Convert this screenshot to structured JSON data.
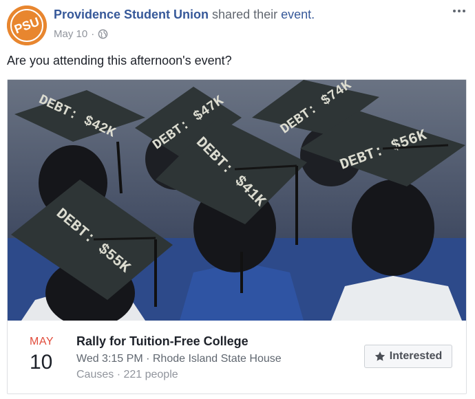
{
  "post": {
    "author": "Providence Student Union",
    "action": "shared their",
    "event_link": "event.",
    "date": "May 10",
    "separator": "·",
    "privacy_icon": "globe-icon",
    "text": "Are you attending this afternoon's event?",
    "avatar_text": "PSU",
    "more_icon": "more-icon"
  },
  "image": {
    "cap_texts": [
      "DEBT: $42K",
      "DEBT: $47K",
      "DEBT: $55K",
      "DEBT: $74K",
      "DEBT: $56K",
      "DEBT: $41K"
    ]
  },
  "event": {
    "month": "MAY",
    "day": "10",
    "title": "Rally for Tuition-Free College",
    "when": "Wed 3:15 PM · Rhode Island State House",
    "stats": "Causes · 221 people",
    "interested_label": "Interested",
    "interested_icon": "star-icon"
  },
  "colors": {
    "link": "#365899",
    "month": "#e14c3b",
    "avatar": "#e8862f"
  }
}
